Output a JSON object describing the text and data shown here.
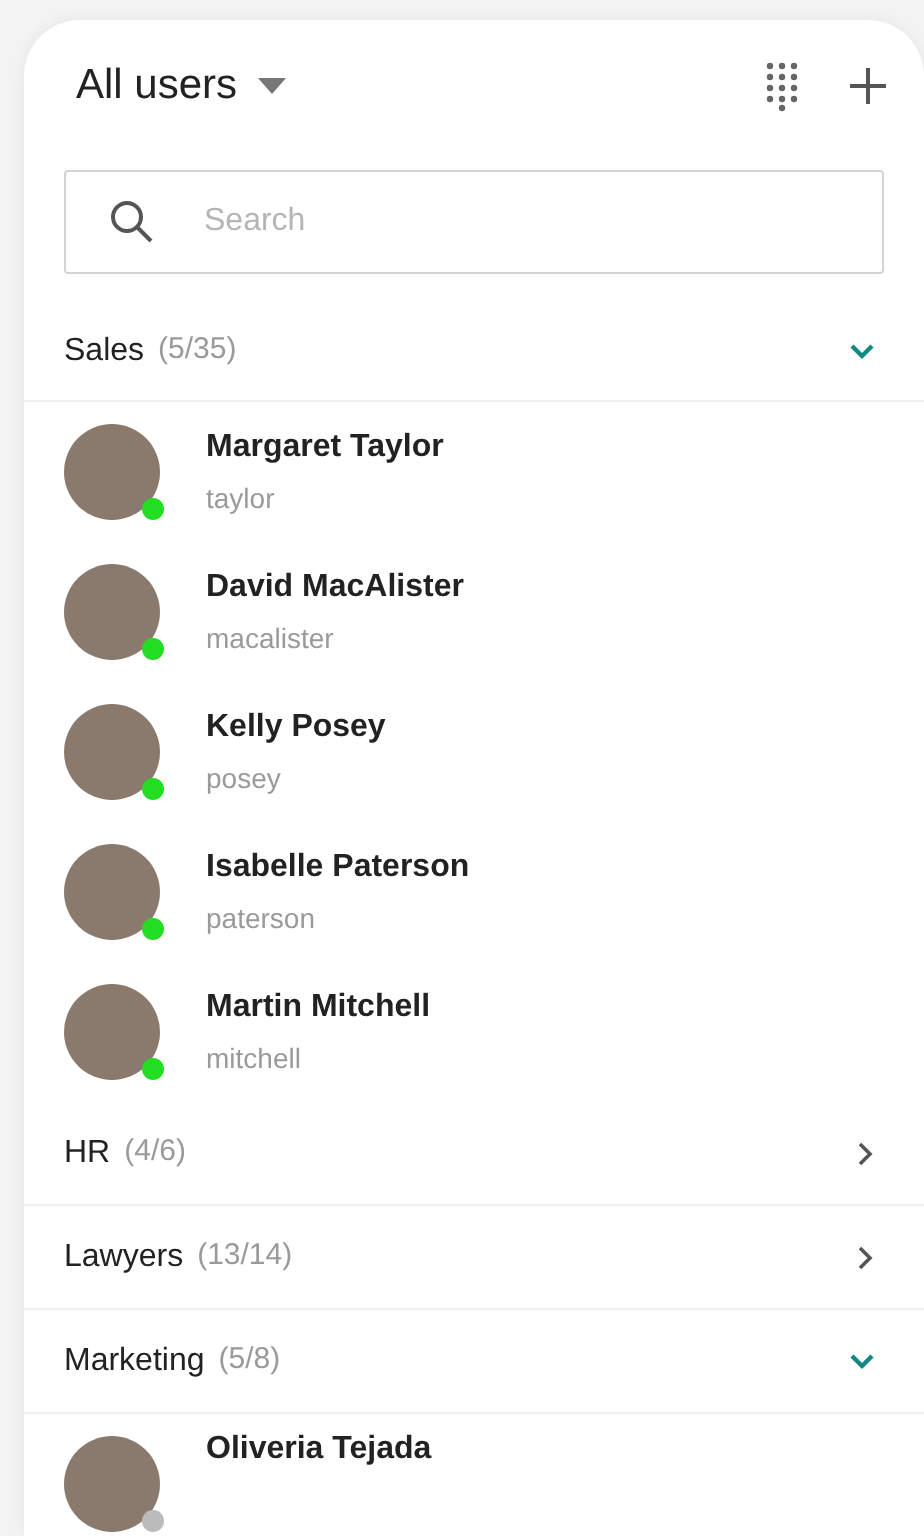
{
  "header": {
    "title": "All users"
  },
  "search": {
    "placeholder": "Search"
  },
  "groups": [
    {
      "name": "Sales",
      "count": "(5/35)",
      "expanded": true,
      "users": [
        {
          "name": "Margaret Taylor",
          "username": "taylor",
          "online": true
        },
        {
          "name": "David MacAlister",
          "username": "macalister",
          "online": true
        },
        {
          "name": "Kelly Posey",
          "username": "posey",
          "online": true
        },
        {
          "name": "Isabelle Paterson",
          "username": "paterson",
          "online": true
        },
        {
          "name": "Martin Mitchell",
          "username": "mitchell",
          "online": true
        }
      ]
    },
    {
      "name": "HR",
      "count": "(4/6)",
      "expanded": false
    },
    {
      "name": "Lawyers",
      "count": "(13/14)",
      "expanded": false
    },
    {
      "name": "Marketing",
      "count": "(5/8)",
      "expanded": true,
      "users": [
        {
          "name": "Oliveria Tejada",
          "online": false
        }
      ]
    }
  ]
}
